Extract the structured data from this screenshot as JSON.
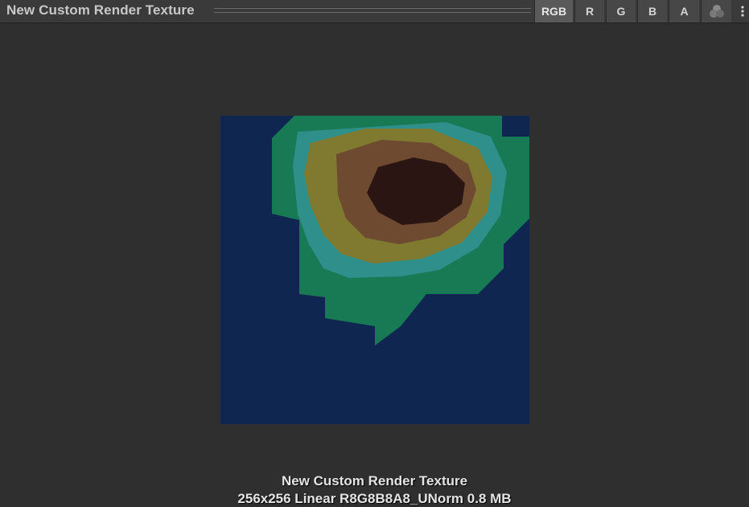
{
  "window": {
    "title": "New Custom Render Texture"
  },
  "channels": [
    {
      "label": "RGB",
      "active": true
    },
    {
      "label": "R",
      "active": false
    },
    {
      "label": "G",
      "active": false
    },
    {
      "label": "B",
      "active": false
    },
    {
      "label": "A",
      "active": false
    }
  ],
  "icons": {
    "mix": "channel-mix-icon",
    "menu": "kebab-menu-icon"
  },
  "preview": {
    "name": "New Custom Render Texture",
    "info": "256x256 Linear  R8G8B8A8_UNorm  0.8 MB",
    "colors": {
      "background": "#0f2650",
      "green": "#177a55",
      "teal": "#2f8f8a",
      "olive": "#7f7a30",
      "brown": "#6e4a30",
      "dark": "#2a1512"
    }
  }
}
